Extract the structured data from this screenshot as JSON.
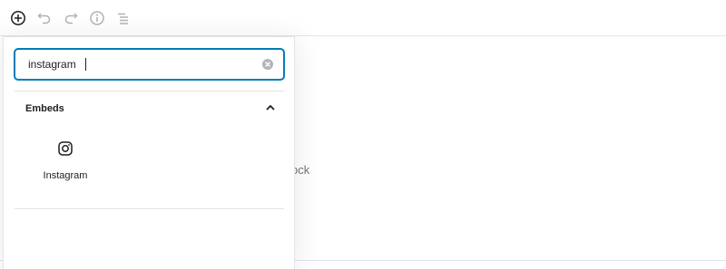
{
  "toolbar": {
    "items": [
      {
        "icon": "add-block-icon"
      },
      {
        "icon": "undo-icon"
      },
      {
        "icon": "redo-icon"
      },
      {
        "icon": "info-icon"
      },
      {
        "icon": "list-view-icon"
      }
    ]
  },
  "editor": {
    "placeholder_fragment": "a block"
  },
  "inserter": {
    "search": {
      "value": "instagram"
    },
    "panel": {
      "title": "Embeds",
      "blocks": [
        {
          "label": "Instagram",
          "icon": "instagram-icon"
        }
      ]
    }
  },
  "colors": {
    "accent": "#007cba",
    "border": "#e2e4e7",
    "icon_disabled": "#b0b5bb",
    "text": "#1e1e1e",
    "muted_text": "#757575"
  }
}
